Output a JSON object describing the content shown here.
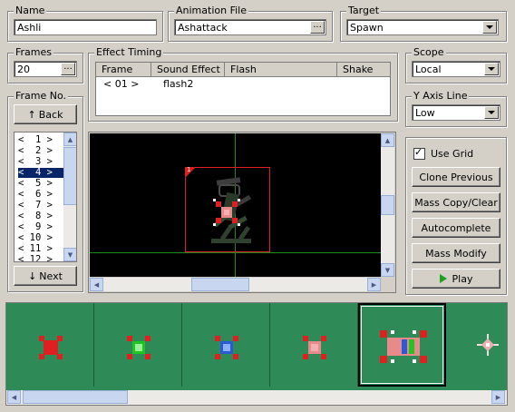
{
  "name_group": {
    "label": "Name",
    "value": "Ashli"
  },
  "anim_group": {
    "label": "Animation File",
    "value": "Ashattack",
    "dots": "..."
  },
  "target_group": {
    "label": "Target",
    "value": "Spawn"
  },
  "frames_group": {
    "label": "Frames",
    "value": "20",
    "dots": "..."
  },
  "timing_group": {
    "label": "Effect Timing",
    "columns": [
      "Frame",
      "Sound Effect",
      "Flash",
      "Shake"
    ],
    "rows": [
      {
        "frame": "< 01 >",
        "sound": "flash2",
        "flash": "",
        "shake": ""
      }
    ]
  },
  "scope_group": {
    "label": "Scope",
    "value": "Local"
  },
  "yaxis_group": {
    "label": "Y Axis Line",
    "value": "Low"
  },
  "frameno_group": {
    "label": "Frame No.",
    "back_label": "Back",
    "next_label": "Next",
    "items": [
      "<  1 >",
      "<  2 >",
      "<  3 >",
      "<  4 >",
      "<  5 >",
      "<  6 >",
      "<  7 >",
      "<  8 >",
      "<  9 >",
      "< 10 >",
      "< 11 >",
      "< 12 >"
    ],
    "selected_index": 3
  },
  "preview": {
    "badge": "1"
  },
  "options": {
    "use_grid_label": "Use Grid",
    "use_grid_checked": true,
    "buttons": [
      "Clone Previous",
      "Mass Copy/Clear",
      "Autocomplete",
      "Mass Modify",
      "Play"
    ]
  },
  "colors": {
    "timeline_bg": "#2e8b57",
    "preview_bg": "#000000",
    "grid_line": "#1a8a1a",
    "selection": "#0a246a"
  }
}
